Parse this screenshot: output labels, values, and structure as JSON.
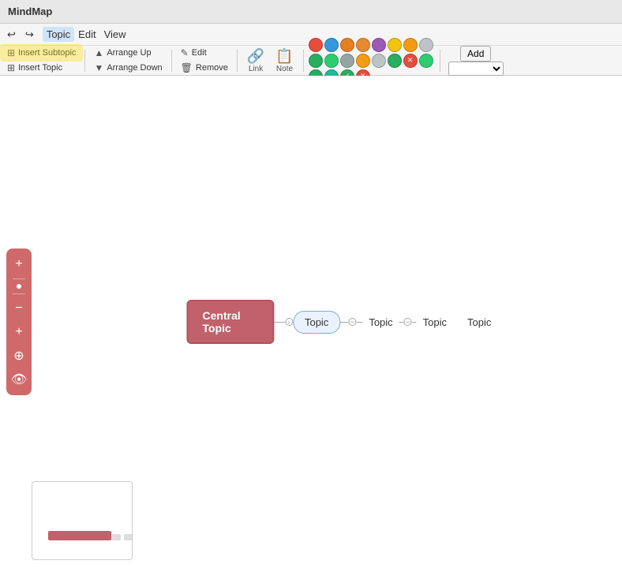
{
  "app": {
    "title": "MindMap"
  },
  "menubar": {
    "undo_label": "↩",
    "redo_label": "↪",
    "topic_label": "Topic",
    "edit_label": "Edit",
    "view_label": "View"
  },
  "toolbar": {
    "insert_subtopic_label": "Insert Subtopic",
    "insert_topic_label": "Insert Topic",
    "arrange_up_label": "Arrange Up",
    "arrange_down_label": "Arrange Down",
    "edit_label": "Edit",
    "remove_label": "Remove",
    "link_label": "Link",
    "note_label": "Note",
    "add_label": "Add"
  },
  "colors": {
    "row1": [
      "#e74c3c",
      "#3498db",
      "#e67e22",
      "#e67e22",
      "#9b59b6",
      "#f1c40f",
      "#f39c12",
      "#bdc3c7",
      "#27ae60",
      "#2ecc71"
    ],
    "row2": [
      "#7f8c8d",
      "#f39c12",
      "#95a5a6",
      "#27ae60",
      "#e74c3c",
      "#2ecc71",
      "#27ae60",
      "#16a085",
      "#27ae60",
      "#e74c3c"
    ]
  },
  "mindmap": {
    "central_topic": "Central Topic",
    "topic1": "Topic",
    "topic2": "Topic",
    "topic3": "Topic",
    "topic4": "Topic"
  },
  "minimap": {},
  "sidebar_tools": {
    "plus_icon": "+",
    "minus_icon": "−",
    "crosshair_icon": "⊕",
    "eye_icon": "👁"
  }
}
